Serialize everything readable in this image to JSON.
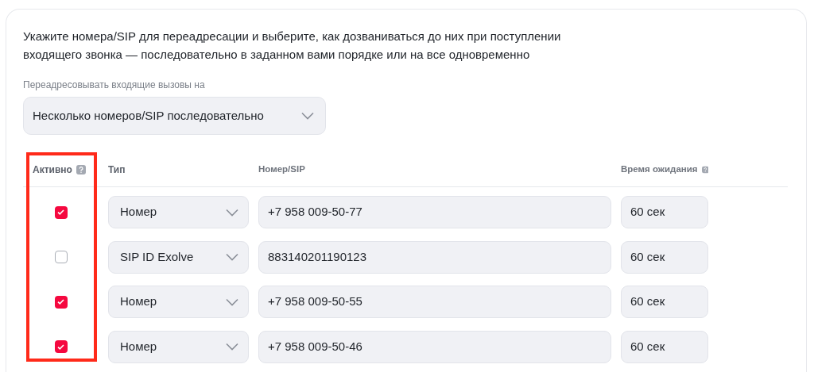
{
  "intro": "Укажите номера/SIP для переадресации и выберите, как дозваниваться до них при поступлении входящего звонка — последовательно в заданном вами порядке или на все одновременно",
  "forward_select": {
    "label": "Переадресовывать входящие вызовы на",
    "value": "Несколько номеров/SIP последовательно"
  },
  "annotation": {
    "kind": "highlight-box"
  },
  "table": {
    "columns": [
      {
        "label": "Активно",
        "help": true
      },
      {
        "label": "Тип",
        "help": false
      },
      {
        "label": "Номер/SIP",
        "help": false
      },
      {
        "label": "Время ожидания",
        "help": true
      }
    ],
    "rows": [
      {
        "checked": true,
        "type": "Номер",
        "number": "+7 958 009-50-77",
        "timeout": "60 сек"
      },
      {
        "checked": false,
        "type": "SIP ID Exolve",
        "number": "883140201190123",
        "timeout": "60 сек"
      },
      {
        "checked": true,
        "type": "Номер",
        "number": "+7 958 009-50-55",
        "timeout": "60 сек"
      },
      {
        "checked": true,
        "type": "Номер",
        "number": "+7 958 009-50-46",
        "timeout": "60 сек"
      }
    ]
  }
}
